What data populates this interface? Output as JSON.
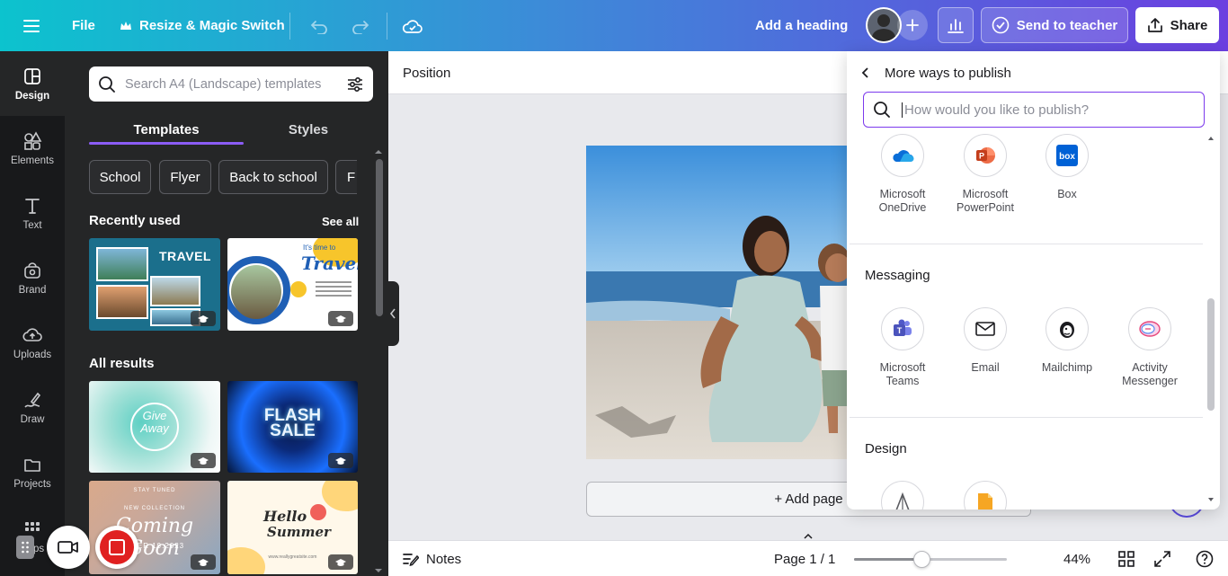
{
  "topbar": {
    "file_label": "File",
    "resize_label": "Resize & Magic Switch",
    "heading_label": "Add a heading",
    "send_label": "Send to teacher",
    "share_label": "Share"
  },
  "rail": {
    "items": [
      {
        "label": "Design",
        "icon": "design-icon"
      },
      {
        "label": "Elements",
        "icon": "elements-icon"
      },
      {
        "label": "Text",
        "icon": "text-icon"
      },
      {
        "label": "Brand",
        "icon": "brand-icon"
      },
      {
        "label": "Uploads",
        "icon": "uploads-icon"
      },
      {
        "label": "Draw",
        "icon": "draw-icon"
      },
      {
        "label": "Projects",
        "icon": "projects-icon"
      },
      {
        "label": "Apps",
        "icon": "apps-icon"
      }
    ]
  },
  "panel": {
    "search_placeholder": "Search A4 (Landscape) templates",
    "tabs": [
      "Templates",
      "Styles"
    ],
    "chips": [
      "School",
      "Flyer",
      "Back to school",
      "F"
    ],
    "recently_used": "Recently used",
    "see_all": "See all",
    "all_results": "All results",
    "thumbs": {
      "travel1": {
        "title": "TRAVEL"
      },
      "travel2": {
        "title": "Travel",
        "tag": "It's time to"
      },
      "giveaway": {
        "line1": "Give",
        "line2": "Away"
      },
      "flash": {
        "line1": "FLASH",
        "line2": "SALE"
      },
      "coming": {
        "top": "STAY TUNED",
        "sub": "NEW COLLECTION",
        "main": "Coming Soon",
        "date": "MBER 19.2023"
      },
      "hello": {
        "line1": "Hello",
        "line2": "Summer",
        "url": "www.reallygreatsite.com"
      }
    }
  },
  "canvas": {
    "position_label": "Position",
    "add_page_label": "+ Add page"
  },
  "bottombar": {
    "notes_label": "Notes",
    "page_label": "Page 1 / 1",
    "zoom_label": "44%",
    "zoom_fraction": 0.44
  },
  "publish": {
    "title": "More ways to publish",
    "search_placeholder": "How would you like to publish?",
    "storage_apps": [
      {
        "name": "Microsoft OneDrive",
        "line1": "Microsoft",
        "line2": "OneDrive"
      },
      {
        "name": "Microsoft PowerPoint",
        "line1": "Microsoft",
        "line2": "PowerPoint"
      },
      {
        "name": "Box",
        "line1": "Box",
        "line2": ""
      }
    ],
    "messaging_label": "Messaging",
    "messaging_apps": [
      {
        "line1": "Microsoft",
        "line2": "Teams"
      },
      {
        "line1": "Email",
        "line2": ""
      },
      {
        "line1": "Mailchimp",
        "line2": ""
      },
      {
        "line1": "Activity",
        "line2": "Messenger"
      }
    ],
    "design_label": "Design"
  },
  "colors": {
    "accent": "#7c3aed",
    "panel_bg": "#252627",
    "rail_bg": "#18191b"
  }
}
